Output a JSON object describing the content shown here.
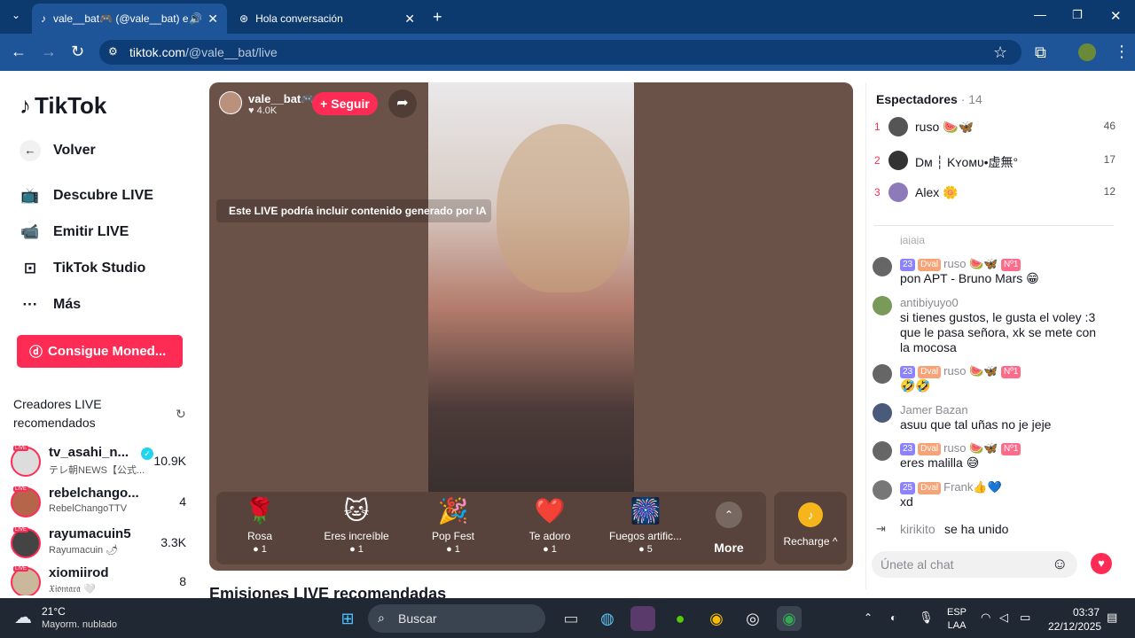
{
  "browser": {
    "tabs": [
      {
        "title": "vale__bat🎮 (@vale__bat) e"
      },
      {
        "title": "Hola conversación"
      }
    ],
    "url_host": "tiktok.com",
    "url_path": "/@vale__bat/live"
  },
  "sidebar": {
    "logo": "TikTok",
    "items": [
      {
        "label": "Volver",
        "icon": "arrow-left-icon"
      },
      {
        "label": "Descubre LIVE",
        "icon": "tv-icon"
      },
      {
        "label": "Emitir LIVE",
        "icon": "camera-icon"
      },
      {
        "label": "TikTok Studio",
        "icon": "studio-icon"
      },
      {
        "label": "Más",
        "icon": "more-icon"
      }
    ],
    "coins_button": "Consigue Moned...",
    "recommended_title": "Creadores LIVE recomendados",
    "creators": [
      {
        "name": "tv_asahi_n...",
        "sub": "テレ朝NEWS【公式...",
        "count": "10.9K"
      },
      {
        "name": "rebelchango...",
        "sub": "RebelChangoTTV",
        "count": "4"
      },
      {
        "name": "rayumacuin5",
        "sub": "Rayumacuin 🌶",
        "count": "3.3K"
      },
      {
        "name": "xiomiirod",
        "sub": "𝔛𝔦𝔬𝔪𝔞𝔯𝔞 🤍",
        "count": "8"
      }
    ]
  },
  "live": {
    "streamer_name": "vale__bat🎮",
    "streamer_likes": "4.0K",
    "follow_label": "+ Seguir",
    "ai_notice": "Este LIVE podría incluir contenido generado por IA",
    "gifts": [
      {
        "name": "Rosa",
        "cost": "1",
        "icon": "🌹"
      },
      {
        "name": "Eres increíble",
        "cost": "1",
        "icon": "🐱"
      },
      {
        "name": "Pop Fest",
        "cost": "1",
        "icon": "🎉"
      },
      {
        "name": "Te adoro",
        "cost": "1",
        "icon": "❤️"
      },
      {
        "name": "Fuegos artific...",
        "cost": "5",
        "icon": "🎆"
      }
    ],
    "more_label": "More",
    "recharge_label": "Recharge ^",
    "recommended_section": "Emisiones LIVE recomendadas"
  },
  "viewers": {
    "title": "Espectadores",
    "count": "· 14",
    "list": [
      {
        "rank": "1",
        "name": "ruso 🍉🦋",
        "score": "46"
      },
      {
        "rank": "2",
        "name": "Dᴍ ┆ Kʏᴏᴍᴜ•虚無°",
        "score": "17"
      },
      {
        "rank": "3",
        "name": "Alex 🌼",
        "score": "12"
      }
    ]
  },
  "chat": {
    "partial": "jajaja",
    "messages": [
      {
        "user": "ruso 🍉🦋",
        "badges": [
          "23",
          "Dval",
          "Nº1"
        ],
        "text": "pon APT - Bruno Mars 😁"
      },
      {
        "user": "antibiyuyo0",
        "badges": [],
        "text": "si tienes gustos, le gusta el voley :3 que le pasa señora, xk se mete con la mocosa"
      },
      {
        "user": "ruso 🍉🦋",
        "badges": [
          "23",
          "Dval",
          "Nº1"
        ],
        "text": "🤣🤣"
      },
      {
        "user": "Jamer Bazan",
        "badges": [],
        "text": "asuu que tal uñas no je jeje"
      },
      {
        "user": "ruso 🍉🦋",
        "badges": [
          "23",
          "Dval",
          "Nº1"
        ],
        "text": "eres malilla 😅"
      },
      {
        "user": "Frank👍💙",
        "badges": [
          "25",
          "Dval"
        ],
        "text": "xd"
      }
    ],
    "join_user": "kirikito",
    "join_text": "se ha unido",
    "input_placeholder": "Únete al chat"
  },
  "taskbar": {
    "temp": "21°C",
    "weather": "Mayorm. nublado",
    "search_placeholder": "Buscar",
    "lang1": "ESP",
    "lang2": "LAA",
    "time": "03:37",
    "date": "22/12/2025"
  },
  "colors": {
    "brand": "#fe2c55",
    "chrome_dark": "#0c3a6e",
    "chrome_light": "#1e5598"
  }
}
